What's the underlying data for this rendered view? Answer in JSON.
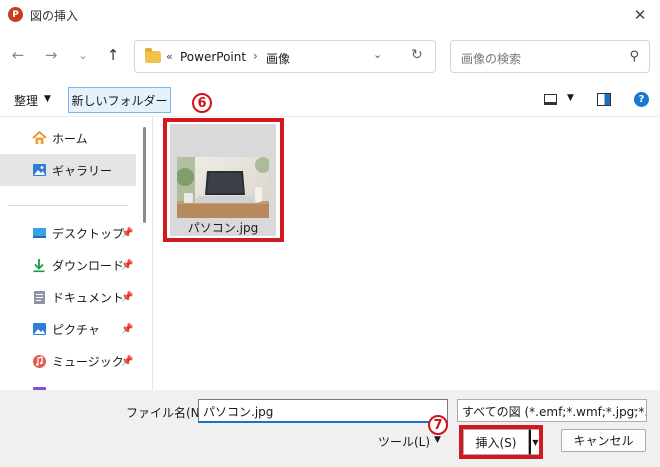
{
  "window": {
    "app_icon": "P",
    "title": "図の挿入",
    "close_icon": "✕"
  },
  "nav": {
    "back_icon": "←",
    "forward_icon": "→",
    "history_icon": "⌄",
    "up_icon": "↑"
  },
  "address": {
    "prefix": "«",
    "crumbs": [
      "PowerPoint",
      "画像"
    ],
    "separator": "›",
    "dropdown_icon": "⌄",
    "refresh_icon": "↻"
  },
  "search": {
    "placeholder": "画像の検索",
    "icon": "⚲"
  },
  "toolbar": {
    "organize_label": "整理",
    "organize_caret": "▼",
    "new_folder_label": "新しいフォルダー",
    "view_caret": "▼",
    "help_icon": "?"
  },
  "annotations": {
    "marker_6": "6",
    "marker_7": "7",
    "color": "#d11a1f"
  },
  "sidebar": {
    "items": [
      {
        "label": "ホーム",
        "icon": "home-icon"
      },
      {
        "label": "ギャラリー",
        "icon": "gallery-icon",
        "selected": true
      },
      {
        "label": "デスクトップ",
        "icon": "desktop-icon",
        "pinned": true
      },
      {
        "label": "ダウンロード",
        "icon": "download-icon",
        "pinned": true
      },
      {
        "label": "ドキュメント",
        "icon": "document-icon",
        "pinned": true
      },
      {
        "label": "ピクチャ",
        "icon": "pictures-icon",
        "pinned": true
      },
      {
        "label": "ミュージック",
        "icon": "music-icon",
        "pinned": true
      }
    ],
    "pin_icon": "✎"
  },
  "files": [
    {
      "name": "パソコン.jpg",
      "thumbnail": "laptop-photo"
    }
  ],
  "bottom": {
    "filename_label": "ファイル名(N):",
    "filename_value": "パソコン.jpg",
    "filter_value": "すべての図 (*.emf;*.wmf;*.jpg;*.jp",
    "filter_caret": "⌄",
    "tools_label": "ツール(L)",
    "tools_caret": "▼",
    "insert_label": "挿入(S)",
    "insert_split_caret": "▼",
    "cancel_label": "キャンセル"
  }
}
